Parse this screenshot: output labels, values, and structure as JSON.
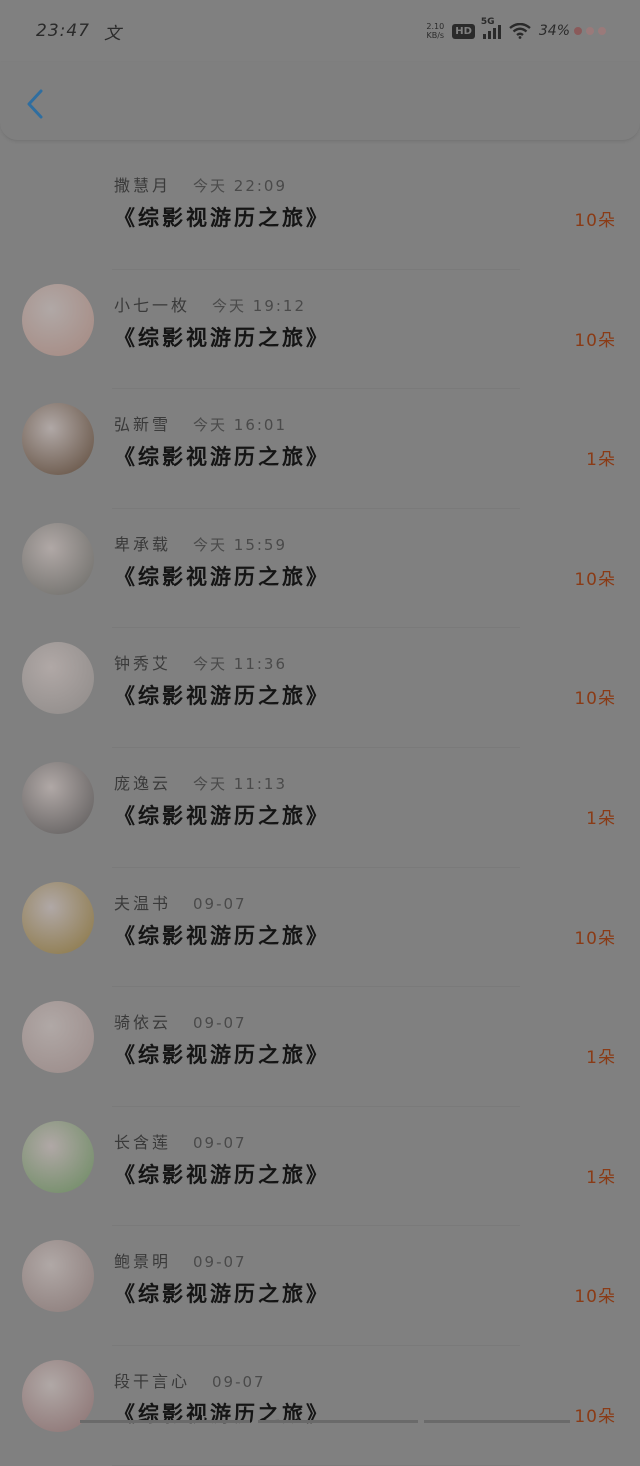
{
  "status_bar": {
    "time": "23:47",
    "extra": "文",
    "net_speed_value": "2.10",
    "net_speed_unit": "KB/s",
    "hd": "HD",
    "network": "5G",
    "battery": "34%"
  },
  "header": {
    "back_icon": "chevron-left-icon",
    "accent_color": "#2f6ea0"
  },
  "gifts": [
    {
      "user": "撒慧月",
      "time": "今天 22:09",
      "title": "《综影视游历之旅》",
      "amount": "10朵",
      "avatar_color": "#8a9aa0"
    },
    {
      "user": "小七一枚",
      "time": "今天 19:12",
      "title": "《综影视游历之旅》",
      "amount": "10朵",
      "avatar_color": "#a58880"
    },
    {
      "user": "弘新雪",
      "time": "今天 16:01",
      "title": "《综影视游历之旅》",
      "amount": "1朵",
      "avatar_color": "#5e4a3a"
    },
    {
      "user": "卑承载",
      "time": "今天 15:59",
      "title": "《综影视游历之旅》",
      "amount": "10朵",
      "avatar_color": "#6a6a66"
    },
    {
      "user": "钟秀艾",
      "time": "今天 11:36",
      "title": "《综影视游历之旅》",
      "amount": "10朵",
      "avatar_color": "#8e8a88"
    },
    {
      "user": "庞逸云",
      "time": "今天 11:13",
      "title": "《综影视游历之旅》",
      "amount": "1朵",
      "avatar_color": "#5a5858"
    },
    {
      "user": "夫温书",
      "time": "09-07",
      "title": "《综影视游历之旅》",
      "amount": "10朵",
      "avatar_color": "#8a7540"
    },
    {
      "user": "骑依云",
      "time": "09-07",
      "title": "《综影视游历之旅》",
      "amount": "1朵",
      "avatar_color": "#9a8a88"
    },
    {
      "user": "长含莲",
      "time": "09-07",
      "title": "《综影视游历之旅》",
      "amount": "1朵",
      "avatar_color": "#6a8a60"
    },
    {
      "user": "鲍景明",
      "time": "09-07",
      "title": "《综影视游历之旅》",
      "amount": "10朵",
      "avatar_color": "#8a7a78"
    },
    {
      "user": "段干言心",
      "time": "09-07",
      "title": "《综影视游历之旅》",
      "amount": "10朵",
      "avatar_color": "#8a7070"
    }
  ]
}
